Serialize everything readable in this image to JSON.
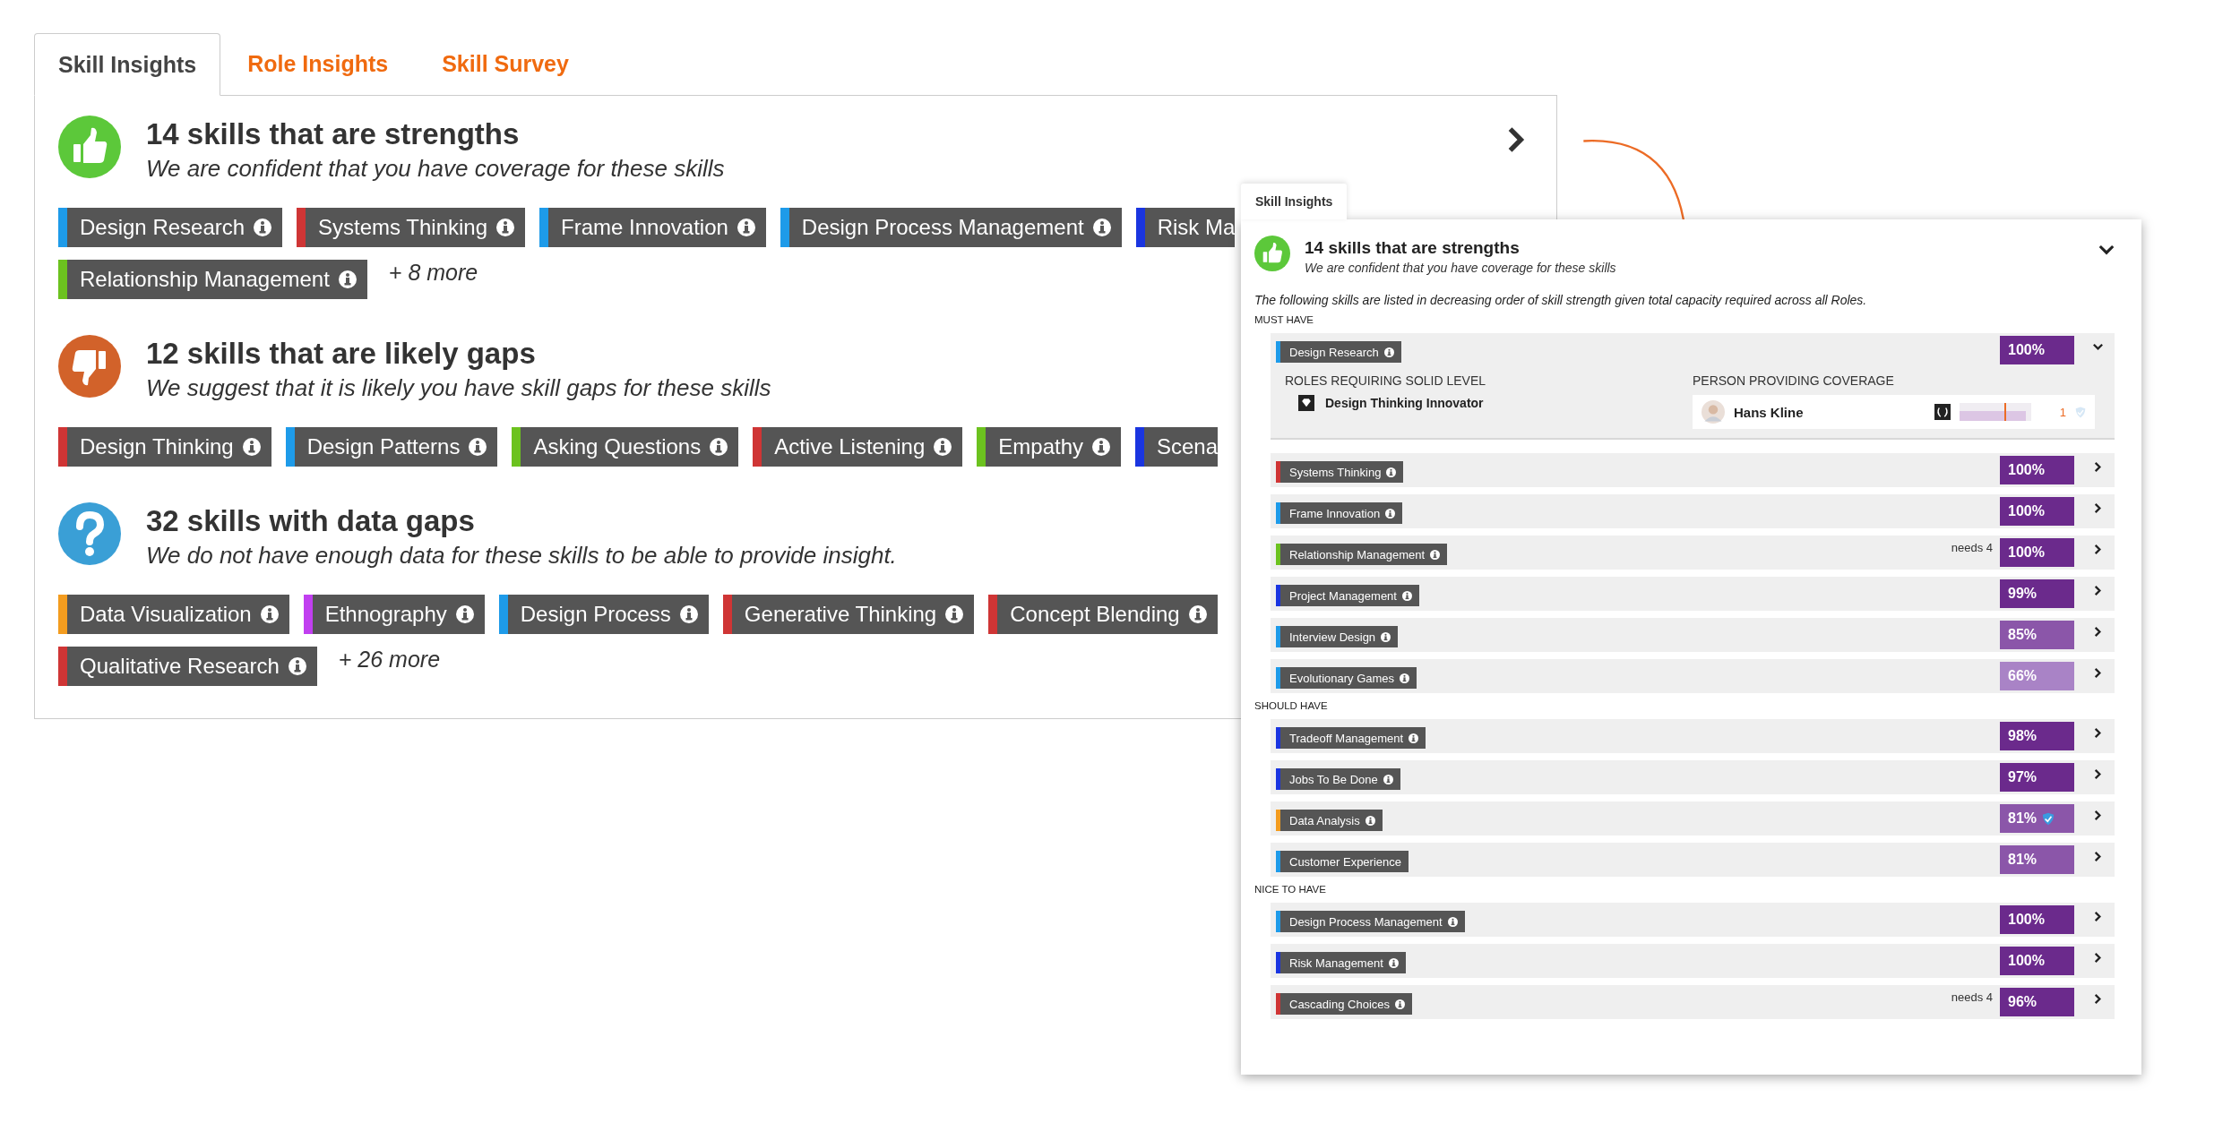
{
  "tabs": [
    {
      "label": "Skill Insights",
      "selected": true
    },
    {
      "label": "Role Insights",
      "selected": false
    },
    {
      "label": "Skill Survey",
      "selected": false
    }
  ],
  "sections": [
    {
      "kind": "strength",
      "title": "14 skills that are strengths",
      "subtitle": "We are confident that you have coverage for these skills",
      "toggle": true,
      "chip_rows": [
        [
          {
            "label": "Design Research",
            "color": "#1e9be9",
            "info": true
          },
          {
            "label": "Systems Thinking",
            "color": "#cf3535",
            "info": true
          },
          {
            "label": "Frame Innovation",
            "color": "#1e9be9",
            "info": true
          },
          {
            "label": "Design Process Management",
            "color": "#1e9be9",
            "info": true
          },
          {
            "label": "Risk Ma",
            "color": "#1a35e0",
            "info": false
          }
        ],
        [
          {
            "label": "Relationship Management",
            "color": "#6cc21f",
            "info": true
          }
        ]
      ],
      "more": "+ 8 more"
    },
    {
      "kind": "gap",
      "title": "12 skills that are likely gaps",
      "subtitle": "We suggest that it is likely you have skill gaps for these skills",
      "toggle": false,
      "chip_rows": [
        [
          {
            "label": "Design Thinking",
            "color": "#cf3535",
            "info": true
          },
          {
            "label": "Design Patterns",
            "color": "#1e9be9",
            "info": true
          },
          {
            "label": "Asking Questions",
            "color": "#6cc21f",
            "info": true
          },
          {
            "label": "Active Listening",
            "color": "#cf3535",
            "info": true
          },
          {
            "label": "Empathy",
            "color": "#6cc21f",
            "info": true
          },
          {
            "label": "Scena",
            "color": "#1a35e0",
            "info": false
          }
        ]
      ]
    },
    {
      "kind": "unknown",
      "title": "32 skills with data gaps",
      "subtitle": "We do not have enough data for these skills to be able to provide insight.",
      "toggle": false,
      "chip_rows": [
        [
          {
            "label": "Data Visualization",
            "color": "#f39c1f",
            "info": true
          },
          {
            "label": "Ethnography",
            "color": "#c13ff0",
            "info": true
          },
          {
            "label": "Design Process",
            "color": "#1e9be9",
            "info": true
          },
          {
            "label": "Generative Thinking",
            "color": "#cf3535",
            "info": true
          },
          {
            "label": "Concept Blending",
            "color": "#cf3535",
            "info": true
          }
        ],
        [
          {
            "label": "Qualitative Research",
            "color": "#cf3535",
            "info": true
          }
        ]
      ],
      "more": "+ 26 more"
    }
  ],
  "detail_panel": {
    "tab": "Skill Insights",
    "kind": "strength",
    "title": "14 skills that are strengths",
    "subtitle": "We are confident that you have coverage for these skills",
    "expanded": true,
    "note": "The following skills are listed in decreasing order of skill strength given total capacity required across all Roles.",
    "groups": [
      {
        "label": "MUST HAVE",
        "skills": [
          {
            "label": "Design Research",
            "color": "#1e9be9",
            "info": true,
            "percent": {
              "text": "100%",
              "color": "#6b2a8c"
            },
            "expanded": true,
            "detail": {
              "roles_heading": "ROLES REQUIRING SOLID LEVEL",
              "roles": [
                {
                  "name": "Design Thinking Innovator"
                }
              ],
              "coverage_heading": "PERSON PROVIDING COVERAGE",
              "people": [
                {
                  "name": "Hans Kline",
                  "level": 0.93,
                  "count": "1"
                }
              ]
            }
          },
          {
            "label": "Systems Thinking",
            "color": "#cf3535",
            "info": true,
            "percent": {
              "text": "100%",
              "color": "#6b2a8c"
            },
            "expanded": false
          },
          {
            "label": "Frame Innovation",
            "color": "#1e9be9",
            "info": true,
            "percent": {
              "text": "100%",
              "color": "#6b2a8c"
            },
            "expanded": false
          },
          {
            "label": "Relationship Management",
            "color": "#6cc21f",
            "info": true,
            "percent": {
              "text": "100%",
              "color": "#6b2a8c"
            },
            "needs": "needs 4",
            "expanded": false
          },
          {
            "label": "Project Management",
            "color": "#1a35e0",
            "info": true,
            "percent": {
              "text": "99%",
              "color": "#6b2a8c"
            },
            "expanded": false
          },
          {
            "label": "Interview Design",
            "color": "#1e9be9",
            "info": true,
            "percent": {
              "text": "85%",
              "color": "#8b56a9"
            },
            "expanded": false
          },
          {
            "label": "Evolutionary Games",
            "color": "#1e9be9",
            "info": true,
            "percent": {
              "text": "66%",
              "color": "#a983c6"
            },
            "expanded": false
          }
        ]
      },
      {
        "label": "SHOULD HAVE",
        "skills": [
          {
            "label": "Tradeoff Management",
            "color": "#1a35e0",
            "info": true,
            "percent": {
              "text": "98%",
              "color": "#6b2a8c"
            },
            "expanded": false
          },
          {
            "label": "Jobs To Be Done",
            "color": "#1a35e0",
            "info": true,
            "percent": {
              "text": "97%",
              "color": "#6b2a8c"
            },
            "expanded": false
          },
          {
            "label": "Data Analysis",
            "color": "#f39c1f",
            "info": true,
            "percent": {
              "text": "81%",
              "color": "#8b56a9"
            },
            "verified": true,
            "expanded": false
          },
          {
            "label": "Customer Experience",
            "color": "#1e9be9",
            "info": false,
            "percent": {
              "text": "81%",
              "color": "#8b56a9"
            },
            "expanded": false
          }
        ]
      },
      {
        "label": "NICE TO HAVE",
        "skills": [
          {
            "label": "Design Process Management",
            "color": "#1e9be9",
            "info": true,
            "percent": {
              "text": "100%",
              "color": "#6b2a8c"
            },
            "expanded": false
          },
          {
            "label": "Risk Management",
            "color": "#1a35e0",
            "info": true,
            "percent": {
              "text": "100%",
              "color": "#6b2a8c"
            },
            "expanded": false
          },
          {
            "label": "Cascading Choices",
            "color": "#cf3535",
            "info": true,
            "percent": {
              "text": "96%",
              "color": "#6b2a8c"
            },
            "needs": "needs 4",
            "expanded": false
          }
        ]
      }
    ]
  }
}
